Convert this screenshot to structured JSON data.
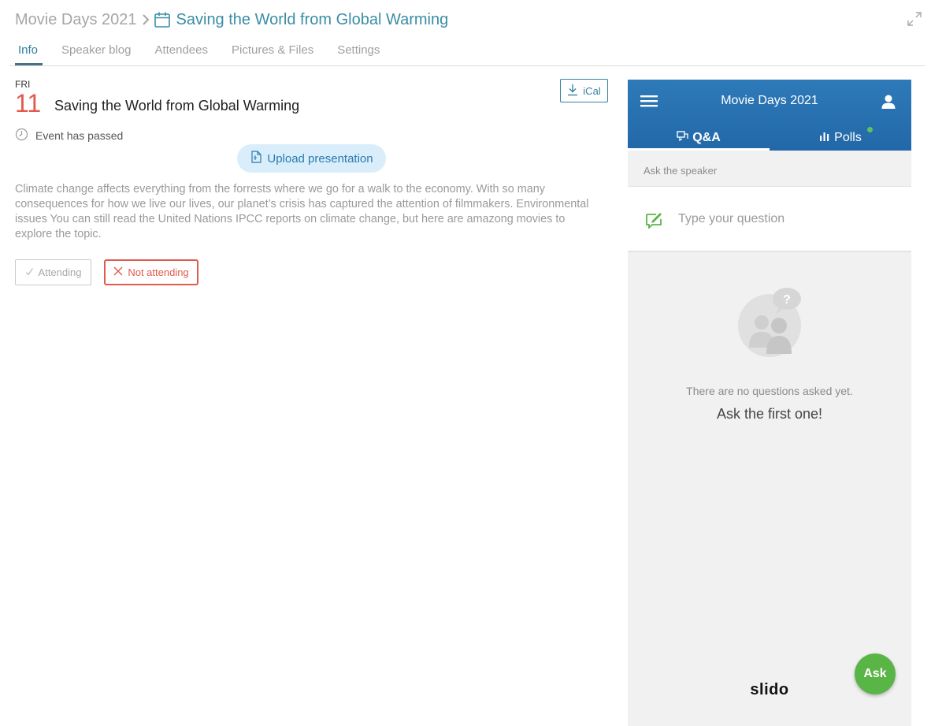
{
  "breadcrumb": {
    "parent": "Movie Days 2021",
    "current": "Saving the World from Global Warming"
  },
  "tabs": [
    {
      "label": "Info",
      "active": true
    },
    {
      "label": "Speaker blog",
      "active": false
    },
    {
      "label": "Attendees",
      "active": false
    },
    {
      "label": "Pictures & Files",
      "active": false
    },
    {
      "label": "Settings",
      "active": false
    }
  ],
  "event": {
    "day_of_week": "FRI",
    "day": "11",
    "title": "Saving the World from Global Warming",
    "status": "Event has passed",
    "ical_label": "iCal",
    "upload_label": "Upload presentation",
    "description": "Climate change affects everything from the forrests where we go for a walk to the economy. With so many consequences for how we live our lives, our planet’s crisis has captured the attention of filmmakers. Environmental issues You can still read the United Nations IPCC reports on climate change, but here are amazong movies to explore the topic.",
    "attending_label": "Attending",
    "not_attending_label": "Not attending"
  },
  "slido": {
    "title": "Movie Days 2021",
    "tab_qa": "Q&A",
    "tab_polls": "Polls",
    "ask_label": "Ask the speaker",
    "question_placeholder": "Type your question",
    "empty_line1": "There are no questions asked yet.",
    "empty_line2": "Ask the first one!",
    "logo": "slido",
    "ask_button": "Ask"
  },
  "colors": {
    "accent": "#3a8da6",
    "date_red": "#e05a4e",
    "slido_blue": "#2268a8",
    "slido_green": "#5ab547"
  },
  "icons": [
    "calendar-icon",
    "chevron-right-icon",
    "expand-icon",
    "download-icon",
    "clock-icon",
    "upload-icon",
    "check-icon",
    "close-icon",
    "menu-icon",
    "user-icon",
    "chat-icon",
    "bar-chart-icon",
    "compose-icon",
    "question-people-icon"
  ]
}
